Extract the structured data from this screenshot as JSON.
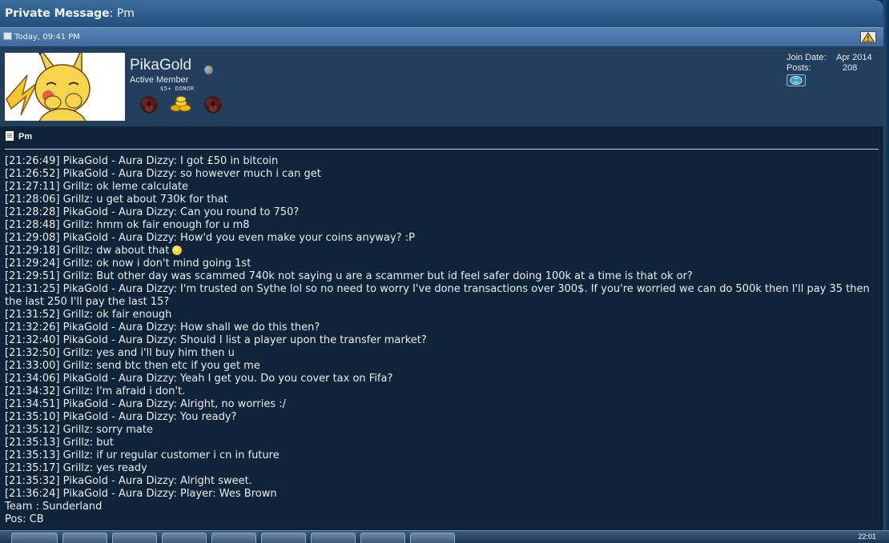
{
  "window": {
    "title_bold": "Private Message",
    "title_rest": ": Pm"
  },
  "post": {
    "date": "Today, 09:41 PM",
    "icons": {
      "post": "document-icon",
      "report": "warning-triangle-icon"
    }
  },
  "user": {
    "name": "PikaGold",
    "status_icon": "offline-dot-icon",
    "title": "Active Member",
    "donor": "$5+ DONOR",
    "badges": [
      "dark-rose-badge-icon",
      "gold-coins-badge-icon",
      "dark-rose-badge-icon"
    ],
    "avatar": "pikachu-avatar",
    "join_date_label": "Join Date:",
    "join_date": "Apr 2014",
    "posts_label": "Posts:",
    "posts": "208",
    "contact_icon": "skype-icon"
  },
  "message": {
    "title": "Pm",
    "lines": [
      "[21:26:49] PikaGold - Aura Dizzy: I got £50 in bitcoin",
      "[21:26:52] PikaGold - Aura Dizzy: so however much i can get",
      "[21:27:11] Grillz: ok leme calculate",
      "[21:28:06] Grillz: u get about 730k for that",
      "[21:28:28] PikaGold - Aura Dizzy: Can you round to 750?",
      "[21:28:48] Grillz: hmm ok fair enough for u m8",
      "[21:29:08] PikaGold - Aura Dizzy: How'd you even make your coins anyway? :P",
      "[21:29:18] Grillz: dw about that",
      "[21:29:24] Grillz: ok now i don't mind going 1st",
      "[21:29:51] Grillz: But other day was scammed 740k not saying u are a scammer but id feel safer doing 100k at a time is that ok or?",
      "[21:31:25] PikaGold - Aura Dizzy: I'm trusted on Sythe lol so no need to worry I've done transactions over 300$. If you're worried we can do 500k then I'll pay 35 then the last 250 I'll pay the last 15?",
      "[21:31:52] Grillz: ok fair enough",
      "[21:32:26] PikaGold - Aura Dizzy: How shall we do this then?",
      "[21:32:40] PikaGold - Aura Dizzy: Should I list a player upon the transfer market?",
      "[21:32:50] Grillz: yes and i'll buy him then u",
      "[21:33:00] Grillz: send btc then etc if you get me",
      "[21:34:06] PikaGold - Aura Dizzy: Yeah I get you. Do you cover tax on Fifa?",
      "[21:34:32] Grillz: I'm afraid i don't.",
      "[21:34:51] PikaGold - Aura Dizzy: Alright, no worries :/",
      "[21:35:10] PikaGold - Aura Dizzy: You ready?",
      "[21:35:12] Grillz: sorry mate",
      "[21:35:13] Grillz: but",
      "[21:35:13] Grillz: if ur regular customer i cn in future",
      "[21:35:17] Grillz: yes ready",
      "[21:35:32] PikaGold - Aura Dizzy: Alright sweet.",
      "[21:36:24] PikaGold - Aura Dizzy: Player: Wes Brown",
      "Team : Sunderland",
      "Pos: CB"
    ],
    "smiley_icon": "smiley-icon"
  },
  "taskbar": {
    "clock": "22:01",
    "buttons": [
      "start-button",
      "app-1",
      "app-2",
      "app-3",
      "app-4",
      "app-5",
      "app-6",
      "app-7",
      "app-8",
      "app-9"
    ]
  }
}
